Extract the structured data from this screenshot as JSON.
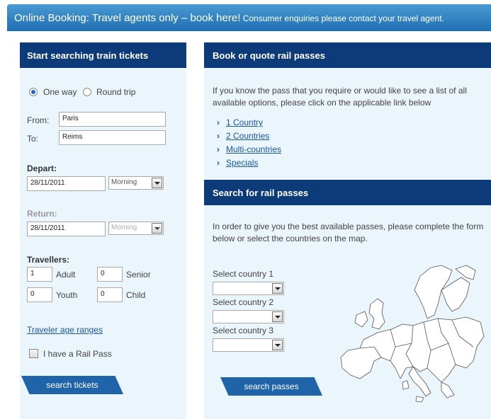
{
  "banner": {
    "main": "Online Booking: Travel agents only – book here!",
    "sub": "Consumer enquiries please contact your travel agent."
  },
  "train": {
    "header": "Start searching train tickets",
    "trip_type": {
      "one_way": "One way",
      "round_trip": "Round trip",
      "selected": "one_way"
    },
    "from_label": "From:",
    "from_value": "Paris",
    "to_label": "To:",
    "to_value": "Reims",
    "depart_label": "Depart:",
    "depart_date": "28/11/2011",
    "depart_time": "Morning",
    "return_label": "Return:",
    "return_date": "28/11/2011",
    "return_time": "Morning",
    "travellers_label": "Travellers:",
    "adult_value": "1",
    "adult_label": "Adult",
    "senior_value": "0",
    "senior_label": "Senior",
    "youth_value": "0",
    "youth_label": "Youth",
    "child_value": "0",
    "child_label": "Child",
    "age_ranges_link": "Traveler age ranges",
    "rail_pass_label": "I have a Rail Pass",
    "search_button": "search tickets"
  },
  "passes": {
    "header": "Book or quote rail passes",
    "intro": "If you know the pass that you require or would like to see a list of all available options, please click on the applicable link below",
    "links": [
      "1 Country",
      "2 Countries",
      "Multi-countries",
      "Specials"
    ]
  },
  "search_passes": {
    "header": "Search for rail passes",
    "intro": "In order to give you the best available passes, please complete the form below or select the countries on the map.",
    "country1_label": "Select country 1",
    "country2_label": "Select country 2",
    "country3_label": "Select country 3",
    "button": "search passes"
  },
  "colors": {
    "header_bg": "#0d3b7a",
    "panel_bg": "#eaf5fc",
    "banner_bg": "#2f83c6",
    "link": "#1a56a6",
    "button": "#1f63a8"
  }
}
